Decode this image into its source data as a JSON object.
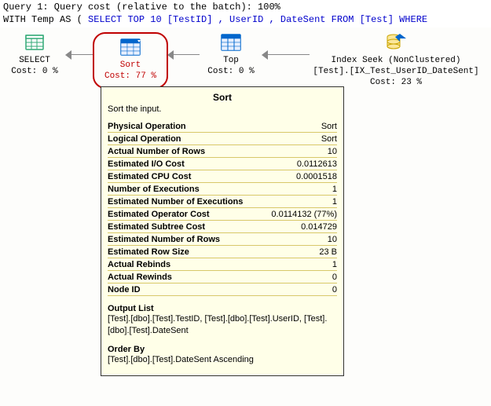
{
  "header": {
    "line1": "Query 1: Query cost (relative to the batch): 100%",
    "line2_prefix": "WITH Temp AS ( ",
    "line2_sql": "SELECT TOP 10 [TestID] , UserID , DateSent FROM [Test] WHERE"
  },
  "ops": {
    "select": {
      "name": "SELECT",
      "cost": "Cost: 0 %"
    },
    "sort": {
      "name": "Sort",
      "cost": "Cost: 77 %"
    },
    "top": {
      "name": "Top",
      "cost": "Cost: 0 %"
    },
    "seek": {
      "name": "Index Seek (NonClustered)",
      "detail": "[Test].[IX_Test_UserID_DateSent]",
      "cost": "Cost: 23 %"
    }
  },
  "tooltip": {
    "title": "Sort",
    "desc": "Sort the input.",
    "rows": [
      {
        "k": "Physical Operation",
        "v": "Sort"
      },
      {
        "k": "Logical Operation",
        "v": "Sort"
      },
      {
        "k": "Actual Number of Rows",
        "v": "10"
      },
      {
        "k": "Estimated I/O Cost",
        "v": "0.0112613"
      },
      {
        "k": "Estimated CPU Cost",
        "v": "0.0001518"
      },
      {
        "k": "Number of Executions",
        "v": "1"
      },
      {
        "k": "Estimated Number of Executions",
        "v": "1"
      },
      {
        "k": "Estimated Operator Cost",
        "v": "0.0114132 (77%)"
      },
      {
        "k": "Estimated Subtree Cost",
        "v": "0.014729"
      },
      {
        "k": "Estimated Number of Rows",
        "v": "10"
      },
      {
        "k": "Estimated Row Size",
        "v": "23 B"
      },
      {
        "k": "Actual Rebinds",
        "v": "1"
      },
      {
        "k": "Actual Rewinds",
        "v": "0"
      },
      {
        "k": "Node ID",
        "v": "0"
      }
    ],
    "output_list_header": "Output List",
    "output_list": "[Test].[dbo].[Test].TestID, [Test].[dbo].[Test].UserID, [Test].[dbo].[Test].DateSent",
    "order_by_header": "Order By",
    "order_by": "[Test].[dbo].[Test].DateSent Ascending"
  }
}
